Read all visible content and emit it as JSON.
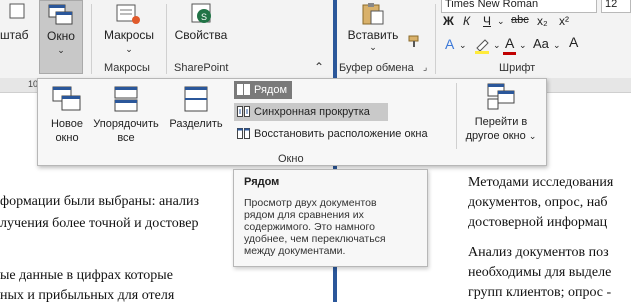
{
  "left_window": {
    "ribbon": {
      "partial_label": "штаб",
      "window_button": "Окно",
      "macros_button": "Макросы",
      "macros_group": "Макросы",
      "properties_button": "Свойства",
      "sharepoint_group": "SharePoint"
    },
    "ruler_number": "10",
    "document_lines": [
      "формации были выбраны: анализ",
      "лучения более точной и достовер",
      "ые данные в цифрах которые",
      "ных и прибыльных для отеля"
    ]
  },
  "right_window": {
    "ribbon": {
      "paste_button": "Вставить",
      "clipboard_group": "Буфер обмена",
      "font_name": "Times New Roman",
      "font_size": "12",
      "bold": "Ж",
      "italic": "К",
      "underline": "Ч",
      "strike": "abc",
      "subscript": "x₂",
      "superscript": "x²",
      "font_group": "Шрифт"
    },
    "document_lines": [
      "Методами исследования",
      "документов, опрос, наб",
      "достоверной информац",
      "Анализ документов поз",
      "необходимы для выделе",
      "групп клиентов; опрос -"
    ]
  },
  "window_panel": {
    "new_window_l1": "Новое",
    "new_window_l2": "окно",
    "arrange_all_l1": "Упорядочить",
    "arrange_all_l2": "все",
    "split": "Разделить",
    "side_by_side": "Рядом",
    "sync_scroll": "Синхронная прокрутка",
    "reset_position": "Восстановить расположение окна",
    "switch_l1": "Перейти в",
    "switch_l2": "другое окно",
    "group_label": "Окно"
  },
  "tooltip": {
    "title": "Рядом",
    "body": [
      "Просмотр двух документов",
      "рядом для сравнения их",
      "содержимого. Это намного",
      "удобнее, чем переключаться",
      "между документами."
    ]
  },
  "colors": {
    "splitter": "#2b579a",
    "active_row": "#7a7a7a",
    "hover_row": "#c9c9c9",
    "sharepoint_green": "#217346"
  }
}
